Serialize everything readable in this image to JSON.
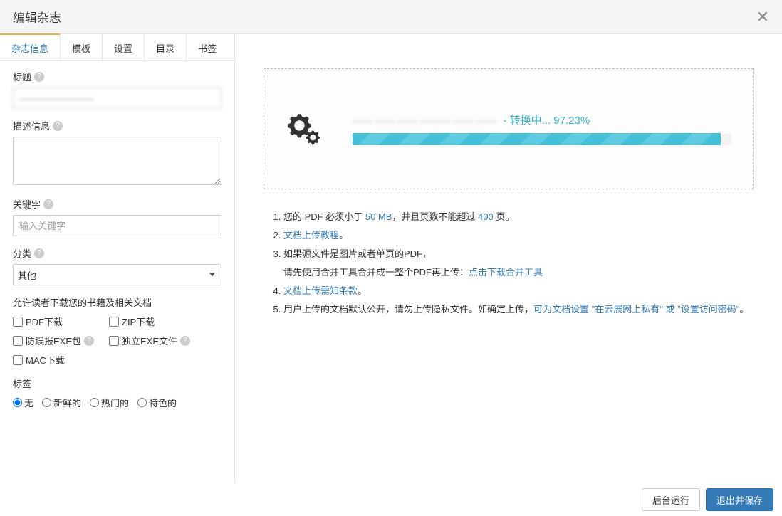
{
  "header": {
    "title": "编辑杂志"
  },
  "tabs": [
    "杂志信息",
    "模板",
    "设置",
    "目录",
    "书签"
  ],
  "form": {
    "title_label": "标题",
    "title_value": "————————",
    "desc_label": "描述信息",
    "desc_value": "",
    "keyword_label": "关键字",
    "keyword_placeholder": "输入关键字",
    "category_label": "分类",
    "category_value": "其他",
    "download_title": "允许读者下载您的书籍及相关文档",
    "dl_pdf": "PDF下载",
    "dl_zip": "ZIP下载",
    "dl_anti": "防误报EXE包",
    "dl_indie": "独立EXE文件",
    "dl_mac": "MAC下载",
    "tags_label": "标签",
    "tag_none": "无",
    "tag_fresh": "新鲜的",
    "tag_hot": "热门的",
    "tag_feat": "特色的"
  },
  "upload": {
    "filename": "—— —— —— ——— —— ——",
    "status_prefix": "- 转换中... ",
    "percent": "97.23%",
    "progress_width": "97.23%"
  },
  "notes": {
    "n1a": "您的 PDF 必须小于 ",
    "n1_link1": "50 MB",
    "n1b": "，并且页数不能超过 ",
    "n1_link2": "400",
    "n1c": " 页。",
    "n2_link": "文档上传教程",
    "n2_suffix": "。",
    "n3a": "如果源文件是图片或者单页的PDF，",
    "n3b": "请先使用合并工具合并成一整个PDF再上传：",
    "n3_link": "点击下载合并工具",
    "n4_link": "文档上传需知条款",
    "n4_suffix": "。",
    "n5a": "用户上传的文档默认公开，请勿上传隐私文件。如确定上传，",
    "n5_link": "可为文档设置 \"在云展网上私有\" 或 \"设置访问密码\"",
    "n5_suffix": "。"
  },
  "footer": {
    "bg_run": "后台运行",
    "save_exit": "退出并保存"
  }
}
